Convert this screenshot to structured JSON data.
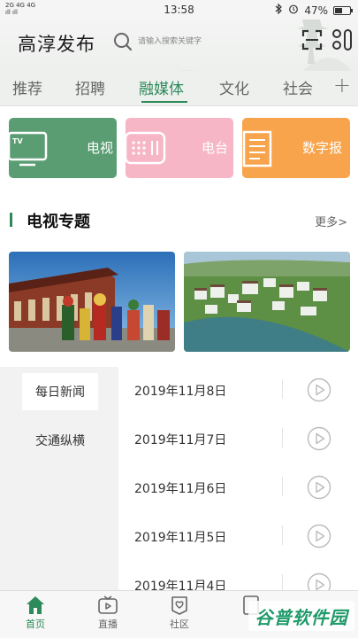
{
  "status_bar": {
    "net_top": "2G 4G 4G",
    "net_bottom": "311 311",
    "time": "13:58",
    "battery_text": "47%",
    "battery_level": 0.47
  },
  "header": {
    "title": "高淳发布",
    "search_placeholder": "请输入搜索关键字"
  },
  "tabs": [
    {
      "label": "推荐",
      "active": false
    },
    {
      "label": "招聘",
      "active": false
    },
    {
      "label": "融媒体",
      "active": true
    },
    {
      "label": "文化",
      "active": false
    },
    {
      "label": "社会",
      "active": false
    }
  ],
  "tab_add": "+",
  "cards": [
    {
      "label": "电视",
      "color": "#5a9d73",
      "icon": "tv-icon"
    },
    {
      "label": "电台",
      "color": "#f6b6c6",
      "icon": "radio-icon"
    },
    {
      "label": "数字报",
      "color": "#f7a44c",
      "icon": "newspaper-icon"
    }
  ],
  "section": {
    "title": "电视专题",
    "more": "更多>"
  },
  "left_menu": [
    {
      "label": "每日新闻",
      "active": true
    },
    {
      "label": "交通纵横",
      "active": false
    }
  ],
  "episodes": [
    {
      "date": "2019年11月8日"
    },
    {
      "date": "2019年11月7日"
    },
    {
      "date": "2019年11月6日"
    },
    {
      "date": "2019年11月5日"
    },
    {
      "date": "2019年11月4日"
    }
  ],
  "bottom_nav": [
    {
      "label": "首页",
      "active": true,
      "icon": "home-icon"
    },
    {
      "label": "直播",
      "active": false,
      "icon": "live-tv-icon"
    },
    {
      "label": "社区",
      "active": false,
      "icon": "community-icon"
    },
    {
      "label": "",
      "active": false,
      "icon": "me-icon"
    }
  ],
  "watermark": "谷普软件园",
  "colors": {
    "accent": "#2d8a5a",
    "tv_card": "#5a9d73",
    "radio_card": "#f6b6c6",
    "paper_card": "#f7a44c"
  }
}
